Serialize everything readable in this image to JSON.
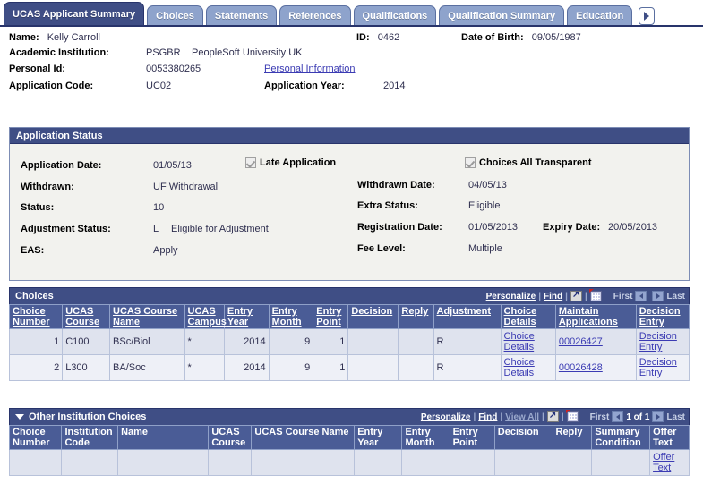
{
  "tabs": [
    {
      "label": "UCAS Applicant Summary",
      "active": true,
      "accel": ""
    },
    {
      "label": "Choices",
      "active": false,
      "accel": "C"
    },
    {
      "label": "Statements",
      "active": false,
      "accel": "m"
    },
    {
      "label": "References",
      "active": false,
      "accel": "R"
    },
    {
      "label": "Qualifications",
      "active": false,
      "accel": "Q"
    },
    {
      "label": "Qualification Summary",
      "active": false,
      "accel": "S"
    },
    {
      "label": "Education",
      "active": false,
      "accel": "d"
    }
  ],
  "tab_next_icon": "chevron-right-icon",
  "header": {
    "name_label": "Name:",
    "name_value": "Kelly Carroll",
    "id_label": "ID:",
    "id_value": "0462",
    "dob_label": "Date of Birth:",
    "dob_value": "09/05/1987",
    "institution_label": "Academic Institution:",
    "institution_code": "PSGBR",
    "institution_name": "PeopleSoft University UK",
    "personal_id_label": "Personal Id:",
    "personal_id_value": "0053380265",
    "personal_information_link": "Personal Information",
    "application_code_label": "Application Code:",
    "application_code_value": "UC02",
    "application_year_label": "Application Year:",
    "application_year_value": "2014"
  },
  "application_status": {
    "title": "Application Status",
    "application_date_label": "Application Date:",
    "application_date_value": "01/05/13",
    "late_application_label": "Late Application",
    "late_application_checked": true,
    "choices_all_transparent_label": "Choices All Transparent",
    "choices_all_transparent_checked": true,
    "withdrawn_label": "Withdrawn:",
    "withdrawn_value": "UF Withdrawal",
    "withdrawn_date_label": "Withdrawn Date:",
    "withdrawn_date_value": "04/05/13",
    "status_label": "Status:",
    "status_value": "10",
    "extra_status_label": "Extra Status:",
    "extra_status_value": "Eligible",
    "adjustment_status_label": "Adjustment Status:",
    "adjustment_status_code": "L",
    "adjustment_status_value": "Eligible for Adjustment",
    "registration_date_label": "Registration Date:",
    "registration_date_value": "01/05/2013",
    "expiry_date_label": "Expiry Date:",
    "expiry_date_value": "20/05/2013",
    "eas_label": "EAS:",
    "eas_value": "Apply",
    "fee_level_label": "Fee Level:",
    "fee_level_value": "Multiple"
  },
  "choices_grid": {
    "title": "Choices",
    "nav": {
      "personalize": "Personalize",
      "find": "Find",
      "sep": "|",
      "zoom_icon": "expand-grid-icon",
      "excel_icon": "download-to-excel-icon",
      "first": "First",
      "prev_icon": "previous-page-icon",
      "next_icon": "next-page-icon",
      "last": "Last",
      "page_count": ""
    },
    "columns": [
      {
        "label": "Choice Number",
        "sortable": true
      },
      {
        "label": "UCAS Course",
        "sortable": true
      },
      {
        "label": "UCAS Course Name",
        "sortable": true
      },
      {
        "label": "UCAS Campus",
        "sortable": true
      },
      {
        "label": "Entry Year",
        "sortable": true
      },
      {
        "label": "Entry Month",
        "sortable": true
      },
      {
        "label": "Entry Point",
        "sortable": true
      },
      {
        "label": "Decision",
        "sortable": true
      },
      {
        "label": "Reply",
        "sortable": true
      },
      {
        "label": "Adjustment",
        "sortable": true
      },
      {
        "label": "Choice Details",
        "sortable": true
      },
      {
        "label": "Maintain Applications",
        "sortable": true
      },
      {
        "label": "Decision Entry",
        "sortable": true
      }
    ],
    "rows": [
      {
        "choice_number": "1",
        "ucas_course": "C100",
        "ucas_course_name": "BSc/Biol",
        "ucas_campus": "*",
        "entry_year": "2014",
        "entry_month": "9",
        "entry_point": "1",
        "decision": "",
        "reply": "",
        "adjustment": "R",
        "choice_details": "Choice Details",
        "maintain_applications": "00026427",
        "decision_entry": "Decision Entry"
      },
      {
        "choice_number": "2",
        "ucas_course": "L300",
        "ucas_course_name": "BA/Soc",
        "ucas_campus": "*",
        "entry_year": "2014",
        "entry_month": "9",
        "entry_point": "1",
        "decision": "",
        "reply": "",
        "adjustment": "R",
        "choice_details": "Choice Details",
        "maintain_applications": "00026428",
        "decision_entry": "Decision Entry"
      }
    ]
  },
  "other_choices_grid": {
    "title": "Other Institution Choices",
    "collapse_icon": "collapse-triangle-icon",
    "nav": {
      "personalize": "Personalize",
      "find": "Find",
      "view_all": "View All",
      "sep": "|",
      "zoom_icon": "expand-grid-icon",
      "excel_icon": "download-to-excel-icon",
      "first": "First",
      "prev_icon": "previous-page-icon",
      "next_icon": "next-page-icon",
      "last": "Last",
      "page_count": "1 of 1"
    },
    "columns": [
      {
        "label": "Choice Number",
        "sortable": false
      },
      {
        "label": "Institution Code",
        "sortable": false
      },
      {
        "label": "Name",
        "sortable": false
      },
      {
        "label": "UCAS Course",
        "sortable": false
      },
      {
        "label": "UCAS Course Name",
        "sortable": false
      },
      {
        "label": "Entry Year",
        "sortable": false
      },
      {
        "label": "Entry Month",
        "sortable": false
      },
      {
        "label": "Entry Point",
        "sortable": false
      },
      {
        "label": "Decision",
        "sortable": false
      },
      {
        "label": "Reply",
        "sortable": false
      },
      {
        "label": "Summary Condition",
        "sortable": false
      },
      {
        "label": "Offer Text",
        "sortable": false
      }
    ],
    "rows": [
      {
        "choice_number": "",
        "institution_code": "",
        "name": "",
        "ucas_course": "",
        "ucas_course_name": "",
        "entry_year": "",
        "entry_month": "",
        "entry_point": "",
        "decision": "",
        "reply": "",
        "summary_condition": "",
        "offer_text": "Offer Text"
      }
    ]
  },
  "colors": {
    "tab_active": "#3f4e85",
    "tab_inactive": "#8ea3cc",
    "grid_header": "#4a5c96",
    "group_header": "#3f4e85",
    "link": "#3b3bb3",
    "row_odd": "#dfe3ee",
    "row_even": "#eef0f7"
  }
}
